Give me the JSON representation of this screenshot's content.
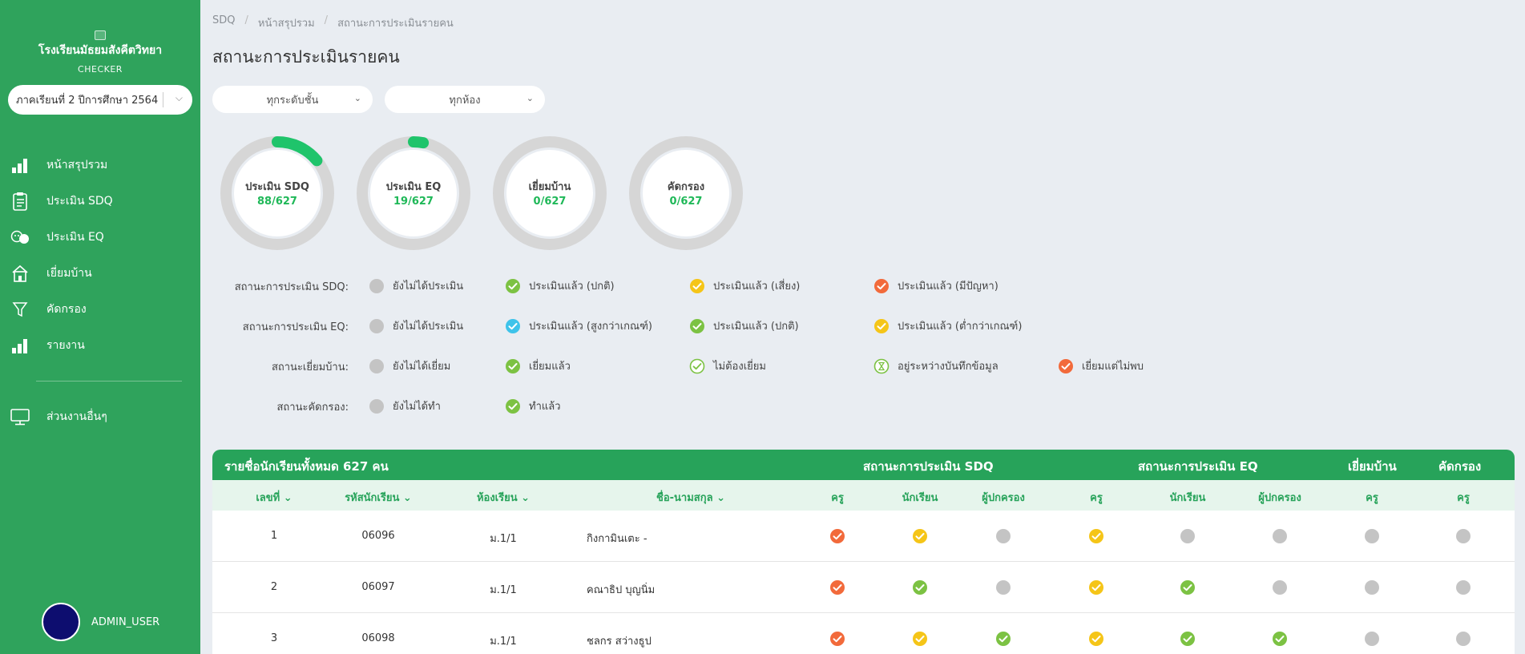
{
  "brand": {
    "school_name": "โรงเรียนมัธยมสังคีตวิทยา",
    "app_name": "CHECKER"
  },
  "term_select": {
    "value": "ภาคเรียนที่ 2 ปีการศึกษา 2564"
  },
  "sidebar": {
    "items": [
      {
        "label": "หน้าสรุปรวม",
        "icon": "bar-chart-icon"
      },
      {
        "label": "ประเมิน SDQ",
        "icon": "clipboard-icon"
      },
      {
        "label": "ประเมิน EQ",
        "icon": "emotions-icon"
      },
      {
        "label": "เยี่ยมบ้าน",
        "icon": "home-icon"
      },
      {
        "label": "คัดกรอง",
        "icon": "filter-icon"
      },
      {
        "label": "รายงาน",
        "icon": "report-chart-icon"
      }
    ],
    "other": {
      "label": "ส่วนงานอื่นๆ",
      "icon": "monitor-icon"
    }
  },
  "user": {
    "name": "ADMIN_USER"
  },
  "breadcrumb": [
    "SDQ",
    "หน้าสรุปรวม",
    "สถานะการประเมินรายคน"
  ],
  "page_title": "สถานะการประเมินรายคน",
  "filters": {
    "grade": "ทุกระดับชั้น",
    "room": "ทุกห้อง"
  },
  "gauges": [
    {
      "label": "ประเมิน SDQ",
      "value_text": "88/627",
      "done": 88,
      "total": 627
    },
    {
      "label": "ประเมิน EQ",
      "value_text": "19/627",
      "done": 19,
      "total": 627
    },
    {
      "label": "เยี่ยมบ้าน",
      "value_text": "0/627",
      "done": 0,
      "total": 627
    },
    {
      "label": "คัดกรอง",
      "value_text": "0/627",
      "done": 0,
      "total": 627
    }
  ],
  "legend": [
    {
      "title": "สถานะการประเมิน SDQ:",
      "items": [
        {
          "label": "ยังไม่ได้ประเมิน",
          "status": "gray"
        },
        {
          "label": "ประเมินแล้ว (ปกติ)",
          "status": "green"
        },
        {
          "label": "ประเมินแล้ว (เสี่ยง)",
          "status": "yellow"
        },
        {
          "label": "ประเมินแล้ว (มีปัญหา)",
          "status": "orange"
        }
      ]
    },
    {
      "title": "สถานะการประเมิน EQ:",
      "items": [
        {
          "label": "ยังไม่ได้ประเมิน",
          "status": "gray"
        },
        {
          "label": "ประเมินแล้ว (สูงกว่าเกณฑ์)",
          "status": "blue"
        },
        {
          "label": "ประเมินแล้ว (ปกติ)",
          "status": "green"
        },
        {
          "label": "ประเมินแล้ว (ต่ำกว่าเกณฑ์)",
          "status": "yellow"
        }
      ]
    },
    {
      "title": "สถานะเยี่ยมบ้าน:",
      "items": [
        {
          "label": "ยังไม่ได้เยี่ยม",
          "status": "gray"
        },
        {
          "label": "เยี่ยมแล้ว",
          "status": "green"
        },
        {
          "label": "ไม่ต้องเยี่ยม",
          "status": "green-outline"
        },
        {
          "label": "อยู่ระหว่างบันทึกข้อมูล",
          "status": "hourglass"
        },
        {
          "label": "เยี่ยมแต่ไม่พบ",
          "status": "orange"
        }
      ]
    },
    {
      "title": "สถานะคัดกรอง:",
      "items": [
        {
          "label": "ยังไม่ได้ทำ",
          "status": "gray"
        },
        {
          "label": "ทำแล้ว",
          "status": "green"
        }
      ]
    }
  ],
  "colors": {
    "primary": "#2fa35c",
    "gray": "#c4c4c4",
    "green": "#7cc243",
    "yellow": "#f5c518",
    "orange": "#f26a3b",
    "blue": "#3ec3ea"
  },
  "table": {
    "title": "รายชื่อนักเรียนทั้งหมด 627 คน",
    "groups": [
      "สถานะการประเมิน SDQ",
      "สถานะการประเมิน EQ",
      "เยี่ยมบ้าน",
      "คัดกรอง"
    ],
    "columns": {
      "no": "เลขที่",
      "student_id": "รหัสนักเรียน",
      "room": "ห้องเรียน",
      "name": "ชื่อ-นามสกุล",
      "sdq_teacher": "ครู",
      "sdq_student": "นักเรียน",
      "sdq_parent": "ผู้ปกครอง",
      "eq_teacher": "ครู",
      "eq_student": "นักเรียน",
      "eq_parent": "ผู้ปกครอง",
      "visit_teacher": "ครู",
      "screen_teacher": "ครู"
    },
    "rows": [
      {
        "no": "1",
        "student_id": "06096",
        "room": "ม.1/1",
        "name": "กิงกามินเตะ -",
        "status": [
          "orange",
          "yellow",
          "gray",
          "yellow",
          "gray",
          "gray",
          "gray",
          "gray"
        ]
      },
      {
        "no": "2",
        "student_id": "06097",
        "room": "ม.1/1",
        "name": "คณาธิป บุญนิ่ม",
        "status": [
          "orange",
          "green",
          "gray",
          "yellow",
          "green",
          "gray",
          "gray",
          "gray"
        ]
      },
      {
        "no": "3",
        "student_id": "06098",
        "room": "ม.1/1",
        "name": "ชลกร สว่างธูป",
        "status": [
          "orange",
          "yellow",
          "green",
          "yellow",
          "green",
          "green",
          "gray",
          "gray"
        ]
      }
    ]
  }
}
